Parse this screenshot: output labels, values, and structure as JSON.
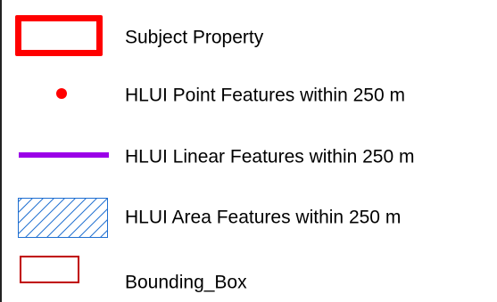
{
  "legend": {
    "items": [
      {
        "label": "Subject Property",
        "symbol": "outlined-rectangle",
        "color": "#ff0000"
      },
      {
        "label": "HLUI Point Features within 250 m",
        "symbol": "dot",
        "color": "#ff0000"
      },
      {
        "label": "HLUI Linear Features within 250 m",
        "symbol": "line",
        "color": "#9b00e8"
      },
      {
        "label": "HLUI Area Features within 250 m",
        "symbol": "hatched-rectangle",
        "color": "#1f6fd1"
      },
      {
        "label": "Bounding_Box",
        "symbol": "thin-outlined-rectangle",
        "color": "#c00000"
      }
    ]
  }
}
